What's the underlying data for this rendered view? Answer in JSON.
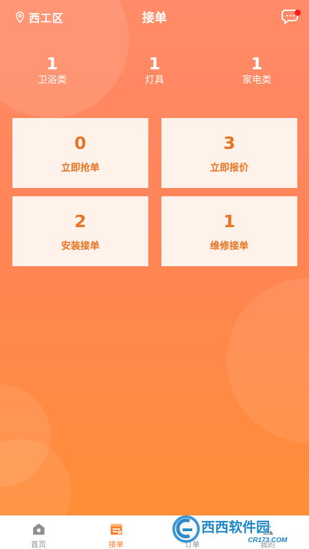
{
  "header": {
    "location": "西工区",
    "title": "接单"
  },
  "stats": [
    {
      "value": "1",
      "label": "卫浴类"
    },
    {
      "value": "1",
      "label": "灯具"
    },
    {
      "value": "1",
      "label": "家电类"
    }
  ],
  "cards": [
    {
      "value": "0",
      "label": "立即抢单"
    },
    {
      "value": "3",
      "label": "立即报价"
    },
    {
      "value": "2",
      "label": "安装接单"
    },
    {
      "value": "1",
      "label": "维修接单"
    }
  ],
  "tabs": [
    {
      "label": "首页",
      "icon": "home-icon"
    },
    {
      "label": "接单",
      "icon": "take-order-icon"
    },
    {
      "label": "订单",
      "icon": "order-icon"
    },
    {
      "label": "我的",
      "icon": "profile-icon"
    }
  ],
  "watermark": {
    "brand": "西西软件园",
    "url": "CR173.COM"
  },
  "colors": {
    "accent": "#ff7d2d",
    "card_text": "#e87424",
    "card_bg": "#fff2ea",
    "notification_dot": "#ff1b1b"
  }
}
